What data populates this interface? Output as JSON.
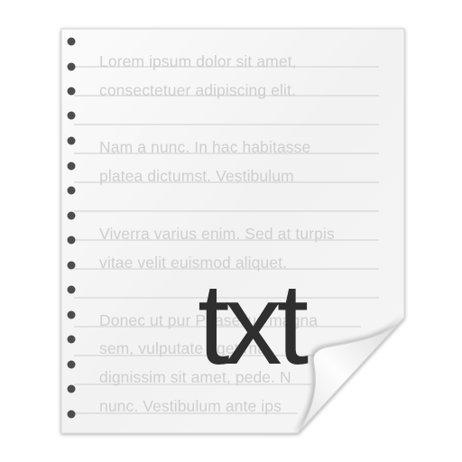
{
  "icon": {
    "type": "text-document-icon",
    "extension_label": "txt",
    "paper_color": "#f7f7f7",
    "rule_color": "#d6d6d6",
    "hole_color": "#555555",
    "text_color": "#cfcfcf",
    "label_color": "#2f2f2f"
  },
  "page_text": {
    "lines": [
      " Lorem ipsum dolor sit amet,",
      "consectetuer adipiscing elit.",
      " Nam a nunc. In hac habitasse",
      "platea dictumst. Vestibulum",
      " Viverra varius enim. Sed at turpis",
      "vitae velit euismod aliquet.",
      " Donec ut pur    Phasellus magna",
      "sem, vulputate eget      rna",
      "dignissim sit amet, pede. N",
      "nunc. Vestibulum ante ips"
    ]
  }
}
